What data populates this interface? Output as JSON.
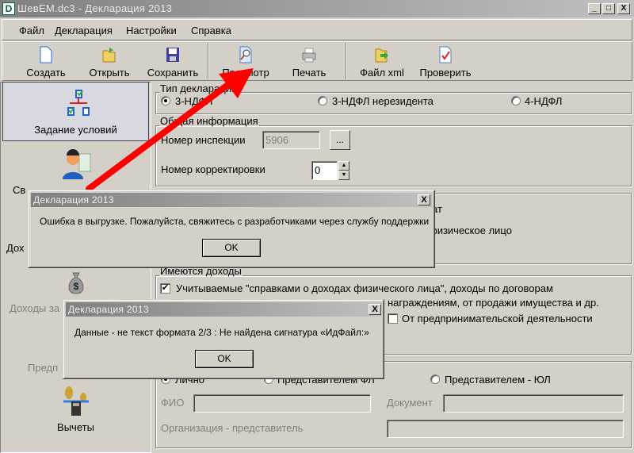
{
  "window": {
    "title": "ШевЕМ.dc3 - Декларация 2013",
    "icon_letter": "D",
    "min": "_",
    "max": "□",
    "close": "X"
  },
  "menu": [
    "Файл",
    "Декларация",
    "Настройки",
    "Справка"
  ],
  "toolbar": [
    {
      "label": "Создать",
      "icon": "new-file-icon"
    },
    {
      "label": "Открыть",
      "icon": "open-folder-icon"
    },
    {
      "label": "Сохранить",
      "icon": "save-disk-icon"
    },
    {
      "label": "Просмотр",
      "icon": "preview-magnifier-icon"
    },
    {
      "label": "Печать",
      "icon": "printer-icon"
    },
    {
      "label": "Файл xml",
      "icon": "export-xml-icon"
    },
    {
      "label": "Проверить",
      "icon": "check-document-icon"
    }
  ],
  "nav": {
    "items": [
      {
        "label": "Задание условий",
        "selected": true
      },
      {
        "label": "Св"
      },
      {
        "label": "Дох"
      },
      {
        "label": "Доходы за"
      },
      {
        "label": "Предп"
      },
      {
        "label": "Вычеты"
      }
    ]
  },
  "decl_type": {
    "title": "Тип декларации",
    "options": [
      "3-НДФЛ",
      "3-НДФЛ нерезидента",
      "4-НДФЛ"
    ],
    "selected": "3-НДФЛ"
  },
  "general": {
    "title": "Общая информация",
    "inspection_label": "Номер инспекции",
    "inspection_value": "5906",
    "browse": "...",
    "correction_label": "Номер корректировки",
    "correction_value": "0"
  },
  "hidden_group": {
    "frag1": "ат",
    "frag2": "физическое лицо"
  },
  "income": {
    "title": "Имеются доходы",
    "line1": "Учитываемые \"справками о доходах физического лица\", доходы по договорам",
    "line2": "награждениям, от продажи имущества и др.",
    "business": "От предпринимательской деятельности",
    "line1_checked": true,
    "business_checked": false
  },
  "submit": {
    "options": [
      "Лично",
      "Представителем ФЛ",
      "Представителем - ЮЛ"
    ],
    "fio_label": "ФИО",
    "doc_label": "Документ",
    "org_label": "Организация - представитель"
  },
  "dialog1": {
    "title": "Декларация 2013",
    "message": "Ошибка в выгрузке. Пожалуйста, свяжитесь с разработчиками через службу поддержки",
    "ok": "OK",
    "close": "X"
  },
  "dialog2": {
    "title": "Декларация 2013",
    "message": "Данные - не текст формата 2/3 : Не найдена сигнатура «ИдФайл:»",
    "ok": "OK",
    "close": "X"
  },
  "annotation_color": "#ff0000"
}
